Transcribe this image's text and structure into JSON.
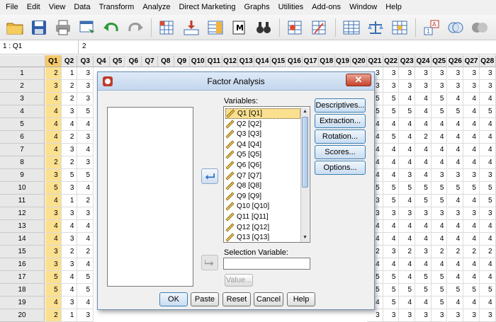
{
  "menu": [
    "File",
    "Edit",
    "View",
    "Data",
    "Transform",
    "Analyze",
    "Direct Marketing",
    "Graphs",
    "Utilities",
    "Add-ons",
    "Window",
    "Help"
  ],
  "cell_ref": {
    "ref": "1 : Q1",
    "value": "2"
  },
  "grid": {
    "columns": [
      "Q1",
      "Q2",
      "Q3",
      "Q4",
      "Q5",
      "Q6",
      "Q7",
      "Q8",
      "Q9",
      "Q10",
      "Q11",
      "Q12",
      "Q13",
      "Q14",
      "Q15",
      "Q16",
      "Q17",
      "Q18",
      "Q19",
      "Q20",
      "Q21",
      "Q22",
      "Q23",
      "Q24",
      "Q25",
      "Q26",
      "Q27",
      "Q28"
    ],
    "rows": [
      {
        "n": "1",
        "left": [
          "2",
          "1",
          "3"
        ],
        "right": [
          "3",
          "3",
          "3",
          "3",
          "3",
          "3",
          "3",
          "3"
        ]
      },
      {
        "n": "2",
        "left": [
          "3",
          "2",
          "3"
        ],
        "right": [
          "3",
          "3",
          "3",
          "3",
          "3",
          "3",
          "3",
          "3"
        ]
      },
      {
        "n": "3",
        "left": [
          "4",
          "2",
          "3"
        ],
        "right": [
          "5",
          "5",
          "4",
          "4",
          "5",
          "4",
          "4",
          "4"
        ]
      },
      {
        "n": "4",
        "left": [
          "4",
          "3",
          "5"
        ],
        "right": [
          "5",
          "5",
          "5",
          "4",
          "5",
          "5",
          "4",
          "5"
        ]
      },
      {
        "n": "5",
        "left": [
          "4",
          "4",
          "4"
        ],
        "right": [
          "4",
          "4",
          "4",
          "4",
          "4",
          "4",
          "4",
          "4"
        ]
      },
      {
        "n": "6",
        "left": [
          "4",
          "2",
          "3"
        ],
        "right": [
          "4",
          "5",
          "4",
          "2",
          "4",
          "4",
          "4",
          "4"
        ]
      },
      {
        "n": "7",
        "left": [
          "4",
          "3",
          "4"
        ],
        "right": [
          "4",
          "4",
          "4",
          "4",
          "4",
          "4",
          "4",
          "4"
        ]
      },
      {
        "n": "8",
        "left": [
          "2",
          "2",
          "3"
        ],
        "right": [
          "4",
          "4",
          "4",
          "4",
          "4",
          "4",
          "4",
          "4"
        ]
      },
      {
        "n": "9",
        "left": [
          "3",
          "5",
          "5"
        ],
        "right": [
          "4",
          "4",
          "3",
          "4",
          "3",
          "3",
          "3",
          "3"
        ]
      },
      {
        "n": "10",
        "left": [
          "5",
          "3",
          "4"
        ],
        "right": [
          "5",
          "5",
          "5",
          "5",
          "5",
          "5",
          "5",
          "5"
        ]
      },
      {
        "n": "11",
        "left": [
          "4",
          "1",
          "2"
        ],
        "right": [
          "3",
          "5",
          "4",
          "5",
          "5",
          "4",
          "4",
          "5"
        ]
      },
      {
        "n": "12",
        "left": [
          "3",
          "3",
          "3"
        ],
        "right": [
          "3",
          "3",
          "3",
          "3",
          "3",
          "3",
          "3",
          "3"
        ]
      },
      {
        "n": "13",
        "left": [
          "4",
          "4",
          "4"
        ],
        "right": [
          "4",
          "4",
          "4",
          "4",
          "4",
          "4",
          "4",
          "4"
        ]
      },
      {
        "n": "14",
        "left": [
          "4",
          "3",
          "4"
        ],
        "right": [
          "4",
          "4",
          "4",
          "4",
          "4",
          "4",
          "4",
          "4"
        ]
      },
      {
        "n": "15",
        "left": [
          "3",
          "2",
          "2"
        ],
        "right": [
          "2",
          "3",
          "2",
          "3",
          "2",
          "2",
          "2",
          "2"
        ]
      },
      {
        "n": "16",
        "left": [
          "3",
          "3",
          "4"
        ],
        "right": [
          "4",
          "4",
          "4",
          "4",
          "4",
          "4",
          "4",
          "4"
        ]
      },
      {
        "n": "17",
        "left": [
          "5",
          "4",
          "5"
        ],
        "right": [
          "5",
          "5",
          "4",
          "5",
          "5",
          "4",
          "4",
          "4"
        ]
      },
      {
        "n": "18",
        "left": [
          "5",
          "4",
          "5"
        ],
        "right": [
          "5",
          "5",
          "5",
          "5",
          "5",
          "5",
          "5",
          "5"
        ]
      },
      {
        "n": "19",
        "left": [
          "4",
          "3",
          "4"
        ],
        "right": [
          "4",
          "5",
          "4",
          "4",
          "5",
          "4",
          "4",
          "4"
        ]
      },
      {
        "n": "20",
        "left": [
          "2",
          "1",
          "3"
        ],
        "right": [
          "3",
          "3",
          "3",
          "3",
          "3",
          "3",
          "3",
          "3"
        ]
      }
    ]
  },
  "dialog": {
    "title": "Factor Analysis",
    "variables_label": "Variables:",
    "variables": [
      "Q1 [Q1]",
      "Q2 [Q2]",
      "Q3 [Q3]",
      "Q4 [Q4]",
      "Q5 [Q5]",
      "Q6 [Q6]",
      "Q7 [Q7]",
      "Q8 [Q8]",
      "Q9 [Q9]",
      "Q10 [Q10]",
      "Q11 [Q11]",
      "Q12 [Q12]",
      "Q13 [Q13]"
    ],
    "selection_label": "Selection Variable:",
    "value_button": "Value...",
    "side_buttons": [
      "Descriptives...",
      "Extraction...",
      "Rotation...",
      "Scores...",
      "Options..."
    ],
    "bottom_buttons": [
      "OK",
      "Paste",
      "Reset",
      "Cancel",
      "Help"
    ],
    "close": "✕"
  },
  "colors": {
    "accent": "#3c7fb1",
    "selected_cell": "#fbe08f",
    "selected_header": "#f5c96a"
  }
}
